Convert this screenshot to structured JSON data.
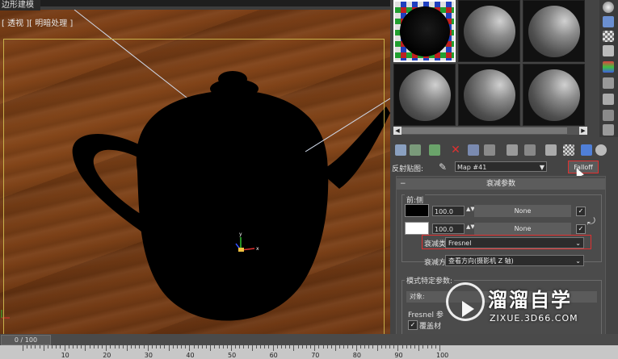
{
  "window": {
    "title": "边形建模"
  },
  "viewport": {
    "label": "[ 透视 ][ 明暗处理 ]"
  },
  "timeline": {
    "slider_label": "0 / 100",
    "ruler_ticks": [
      "10",
      "20",
      "30",
      "40",
      "50",
      "60",
      "70",
      "80",
      "90",
      "100"
    ]
  },
  "material_editor": {
    "reflection_label": "反射贴图:",
    "map_name": "Map #41",
    "map_type": "Falloff",
    "rollout_title": "衰减参数",
    "front_side_group": "前:侧",
    "row1": {
      "value": "100.0",
      "map": "None",
      "color": "#000000"
    },
    "row2": {
      "value": "100.0",
      "map": "None",
      "color": "#ffffff"
    },
    "falloff_type_label": "衰减类型:",
    "falloff_type_value": "Fresnel",
    "falloff_direction_label": "衰减方向:",
    "falloff_direction_value": "查看方向(摄影机 Z 轴)",
    "mode_group": "模式特定参数:",
    "object_label": "对象:",
    "fresnel_label": "Fresnel 参",
    "override_label": "覆盖材"
  },
  "watermark": {
    "title": "溜溜自学",
    "url": "ZIXUE.3D66.COM"
  },
  "colors": {
    "highlight": "#e03030",
    "wood": "#7b3f17"
  }
}
